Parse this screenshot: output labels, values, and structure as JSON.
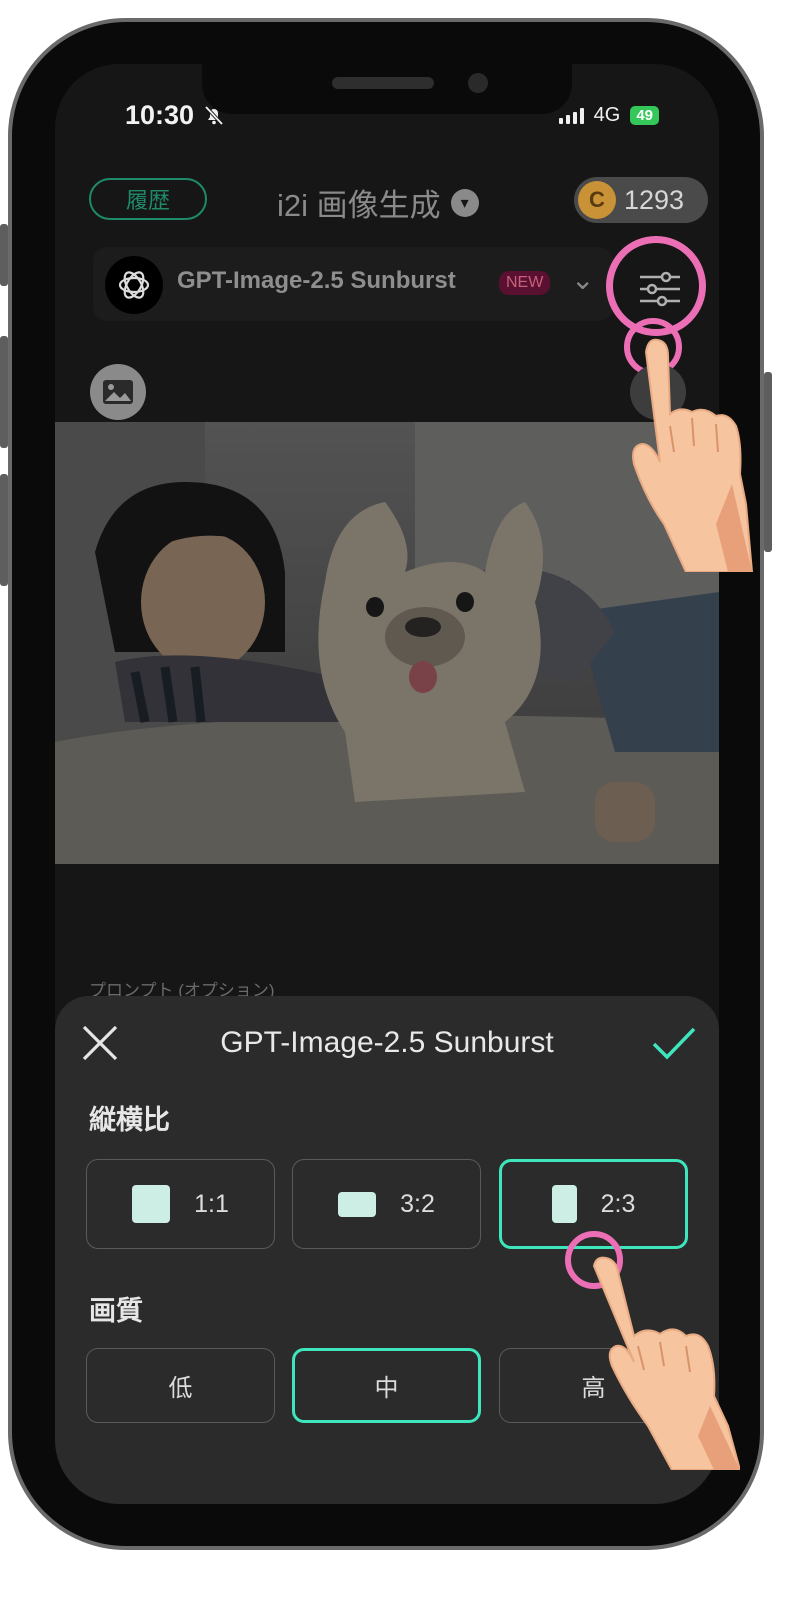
{
  "status": {
    "time": "10:30",
    "network": "4G",
    "battery": "49"
  },
  "header": {
    "history_label": "履歴",
    "title": "i2i 画像生成",
    "coins": "1293"
  },
  "model": {
    "name": "GPT-Image-2.5 Sunburst",
    "badge": "NEW"
  },
  "prompt": {
    "label": "プロンプト (オプション)"
  },
  "sheet": {
    "title": "GPT-Image-2.5 Sunburst",
    "aspect": {
      "label": "縦横比",
      "options": [
        {
          "label": "1:1",
          "selected": false
        },
        {
          "label": "3:2",
          "selected": false
        },
        {
          "label": "2:3",
          "selected": true
        }
      ]
    },
    "quality": {
      "label": "画質",
      "options": [
        {
          "label": "低",
          "selected": false
        },
        {
          "label": "中",
          "selected": true
        },
        {
          "label": "高",
          "selected": false
        }
      ]
    }
  },
  "colors": {
    "accent": "#3ee5bd",
    "highlight": "#ec6fb6",
    "history": "#1f8a6a"
  },
  "icons": [
    "silent-bell-icon",
    "signal-icon",
    "chevron-down-icon",
    "coin-icon",
    "openai-logo-icon",
    "settings-sliders-icon",
    "image-icon",
    "camera-icon",
    "close-icon",
    "check-icon",
    "pointing-hand-icon"
  ]
}
